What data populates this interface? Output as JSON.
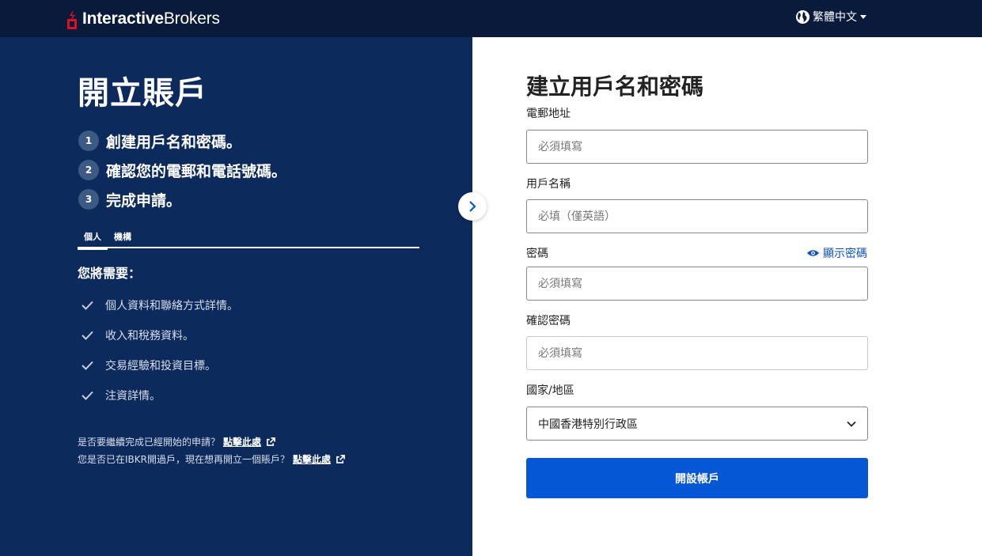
{
  "header": {
    "logo_bold": "Interactive",
    "logo_regular": "Brokers",
    "language": "繁體中文",
    "brand_color": "#d81222"
  },
  "left": {
    "title": "開立賬戶",
    "steps": [
      {
        "num": "1",
        "label": "創建用戶名和密碼。"
      },
      {
        "num": "2",
        "label": "確認您的電郵和電話號碼。"
      },
      {
        "num": "3",
        "label": "完成申請。"
      }
    ],
    "tabs": [
      {
        "label": "個人",
        "active": true
      },
      {
        "label": "機構",
        "active": false
      }
    ],
    "need_title": "您將需要：",
    "requirements": [
      "個人資料和聯絡方式詳情。",
      "收入和稅務資料。",
      "交易經驗和投資目標。",
      "注資詳情。"
    ],
    "links": [
      {
        "text": "是否要繼續完成已經開始的申請？",
        "link": "點擊此處"
      },
      {
        "text": "您是否已在IBKR開過戶，現在想再開立一個賬戶？",
        "link": "點擊此處"
      }
    ]
  },
  "form": {
    "title": "建立用戶名和密碼",
    "email_label": "電郵地址",
    "email_placeholder": "必須填寫",
    "username_label": "用戶名稱",
    "username_placeholder": "必填（僅英語）",
    "password_label": "密碼",
    "password_placeholder": "必須填寫",
    "show_password": "顯示密碼",
    "confirm_label": "確認密碼",
    "confirm_placeholder": "必須填寫",
    "country_label": "國家/地區",
    "country_value": "中國香港特別行政區",
    "submit_label": "開設帳戶",
    "accent_color": "#0657d6"
  }
}
